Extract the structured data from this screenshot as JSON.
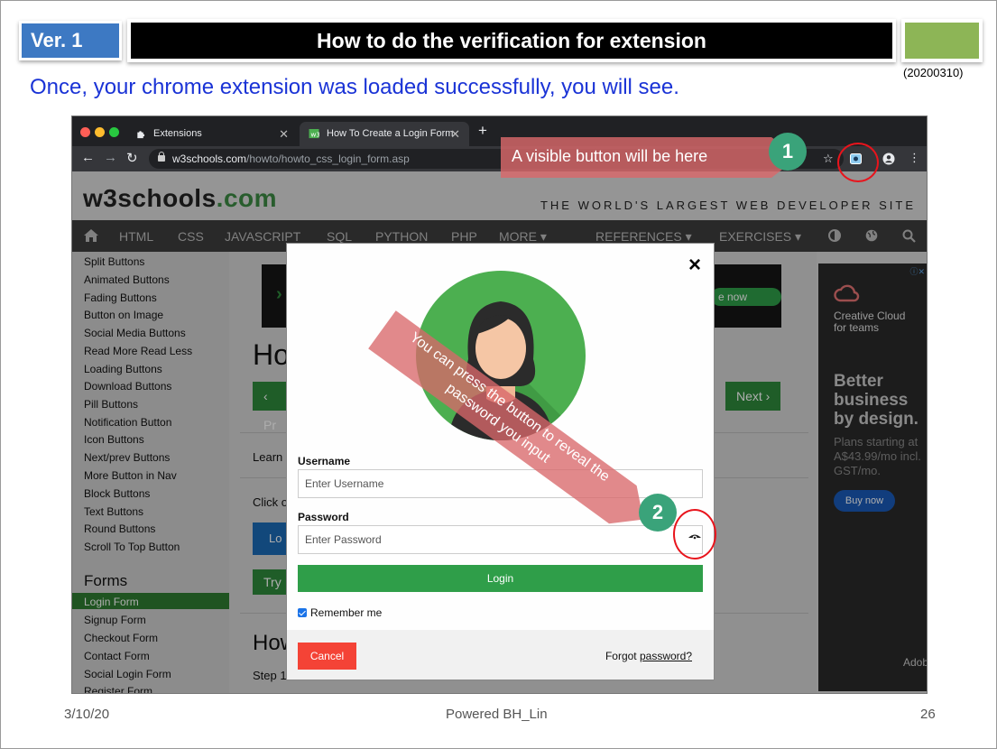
{
  "header": {
    "version": "Ver. 1",
    "title": "How to do the verification for extension",
    "date_code": "(20200310)",
    "subtitle": "Once, your chrome extension was loaded successfully, you will see."
  },
  "browser": {
    "tabs": [
      {
        "label": "Extensions"
      },
      {
        "label": "How To Create a Login Form"
      }
    ],
    "url_host": "w3schools.com",
    "url_path": "/howto/howto_css_login_form.asp",
    "icons": [
      "back-icon",
      "forward-icon",
      "reload-icon",
      "lock-icon",
      "star-icon",
      "extension-icon",
      "profile-icon",
      "menu-icon"
    ]
  },
  "site": {
    "logo_main": "w3schools",
    "logo_suffix": ".com",
    "tagline": "THE WORLD'S LARGEST WEB DEVELOPER SITE",
    "nav": [
      "HTML",
      "CSS",
      "JAVASCRIPT",
      "SQL",
      "PYTHON",
      "PHP",
      "MORE ▾",
      "REFERENCES ▾",
      "EXERCISES ▾"
    ],
    "sidebar_items": [
      "Split Buttons",
      "Animated Buttons",
      "Fading Buttons",
      "Button on Image",
      "Social Media Buttons",
      "Read More Read Less",
      "Loading Buttons",
      "Download Buttons",
      "Pill Buttons",
      "Notification Button",
      "Icon Buttons",
      "Next/prev Buttons",
      "More Button in Nav",
      "Block Buttons",
      "Text Buttons",
      "Round Buttons",
      "Scroll To Top Button"
    ],
    "sidebar_heading": "Forms",
    "sidebar_items2": [
      "Login Form",
      "Signup Form",
      "Checkout Form",
      "Contact Form",
      "Social Login Form",
      "Register Form"
    ],
    "main": {
      "heading_partial": "Ho",
      "prev_label": "‹ Pr",
      "next_label": "Next ›",
      "learn_partial": "Learn",
      "click_partial": "Click o",
      "login_partial": "Lo",
      "try_partial": "Try",
      "heading2_partial": "How",
      "step_partial": "Step 1",
      "ad_now": "e now"
    },
    "right_ad": {
      "brand": "Creative Cloud for teams",
      "headline": "Better business by design.",
      "details": "Plans starting at A$43.99/mo incl. GST/mo.",
      "cta": "Buy now",
      "adobe": "Adobe"
    }
  },
  "modal": {
    "close": "×",
    "username_label": "Username",
    "username_placeholder": "Enter Username",
    "password_label": "Password",
    "password_placeholder": "Enter Password",
    "login_label": "Login",
    "remember_label": "Remember me",
    "remember_checked": true,
    "cancel_label": "Cancel",
    "forgot_prefix": "Forgot ",
    "forgot_link": "password?"
  },
  "annotations": {
    "callout1_text": "A visible button will be here",
    "badge1": "1",
    "badge2": "2",
    "callout2_text": "You can press the button to reveal the password you input"
  },
  "footer": {
    "date": "3/10/20",
    "center": "Powered BH_Lin",
    "page": "26"
  },
  "colors": {
    "version_blue": "#3d79c3",
    "subtitle_blue": "#1a33d6",
    "w3_green": "#2f8a3c",
    "badge_green": "#3aa37a",
    "callout_red": "#d9686a",
    "ring_red": "#e8141c"
  }
}
